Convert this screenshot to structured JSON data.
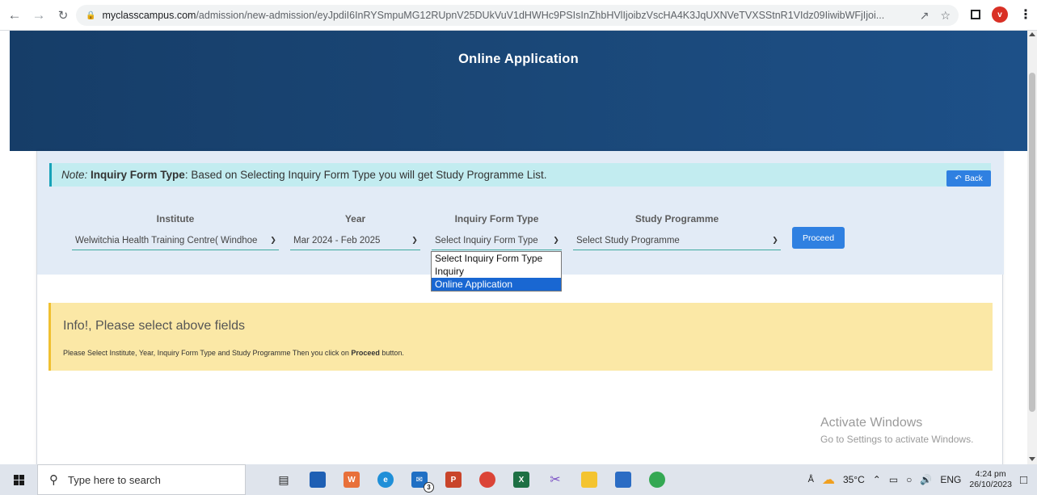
{
  "browser": {
    "url_domain": "myclasscampus.com",
    "url_path": "/admission/new-admission/eyJpdiI6InRYSmpuMG12RUpnV25DUkVuV1dHWHc9PSIsInZhbHVlIjoibzVscHA4K3JqUXNVeTVXSStnR1VIdz09IiwibWFjIjoi...",
    "profile_initial": "v"
  },
  "hero": {
    "title": "Online Application"
  },
  "note": {
    "prefix": "Note:",
    "bold": "Inquiry Form Type",
    "text": ": Based on Selecting Inquiry Form Type you will get Study Programme List."
  },
  "back_label": "Back",
  "form": {
    "institute": {
      "label": "Institute",
      "value": "Welwitchia Health Training Centre( Windhoe"
    },
    "year": {
      "label": "Year",
      "value": "Mar 2024 - Feb 2025"
    },
    "inquiry_type": {
      "label": "Inquiry Form Type",
      "value": "Select Inquiry Form Type",
      "options": [
        "Select Inquiry Form Type",
        "Inquiry",
        "Online Application"
      ]
    },
    "programme": {
      "label": "Study Programme",
      "value": "Select Study Programme"
    },
    "proceed_label": "Proceed"
  },
  "info": {
    "title": "Info!, Please select above fields",
    "text_before": "Please Select Institute, Year, Inquiry Form Type and Study Programme Then you click on ",
    "text_bold": "Proceed",
    "text_after": " button."
  },
  "watermark": {
    "line1": "Activate Windows",
    "line2": "Go to Settings to activate Windows."
  },
  "taskbar": {
    "search_placeholder": "Type here to search",
    "mail_badge": "3",
    "temperature": "35°C",
    "language": "ENG",
    "time": "4:24 pm",
    "date": "26/10/2023"
  }
}
